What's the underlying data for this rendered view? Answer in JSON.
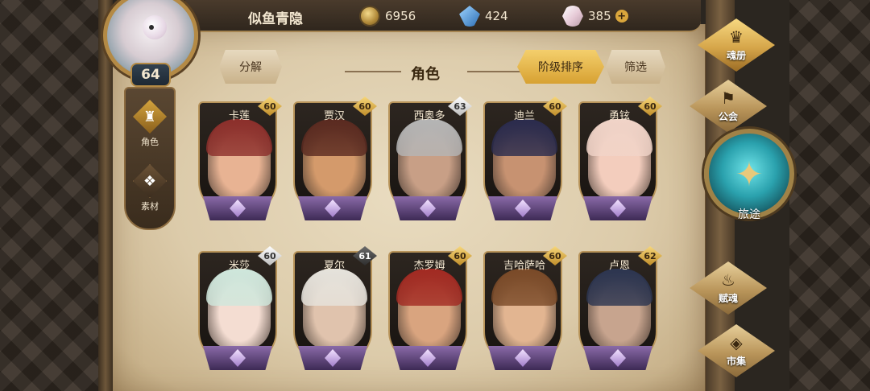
{
  "player": {
    "name": "似鱼青隐",
    "level": "64"
  },
  "resources": {
    "coins": "6956",
    "crystals": "424",
    "gems": "385",
    "add_symbol": "+"
  },
  "leftnav": [
    {
      "label": "角色",
      "icon": "helmet-icon",
      "active": true
    },
    {
      "label": "素材",
      "icon": "beast-icon",
      "active": false
    }
  ],
  "header": {
    "split_label": "分解",
    "title": "角色",
    "sort_label": "阶级排序",
    "filter_label": "筛选"
  },
  "heroes": [
    {
      "name": "卡莲",
      "level": "60",
      "tier": "gold",
      "hair": "#8c2f2b",
      "skin": "#e8b393"
    },
    {
      "name": "贾汉",
      "level": "60",
      "tier": "gold",
      "hair": "#5a2a20",
      "skin": "#d49a6b"
    },
    {
      "name": "西奥多",
      "level": "63",
      "tier": "silver",
      "hair": "#b5b5b5",
      "skin": "#c89f86"
    },
    {
      "name": "迪兰",
      "level": "60",
      "tier": "gold",
      "hair": "#2a2b4d",
      "skin": "#c79271"
    },
    {
      "name": "勇铉",
      "level": "60",
      "tier": "gold",
      "hair": "#f1d4c8",
      "skin": "#f3cdbd"
    },
    {
      "name": "米莎",
      "level": "60",
      "tier": "silver",
      "hair": "#cfe7dc",
      "skin": "#f4ddd2"
    },
    {
      "name": "夏尔",
      "level": "61",
      "tier": "dark",
      "hair": "#e6e3dc",
      "skin": "#e0c3ad"
    },
    {
      "name": "杰罗姆",
      "level": "60",
      "tier": "gold",
      "hair": "#a22a22",
      "skin": "#d9a47f"
    },
    {
      "name": "吉哈萨哈",
      "level": "60",
      "tier": "gold",
      "hair": "#7a4a28",
      "skin": "#e2b591"
    },
    {
      "name": "卢恩",
      "level": "62",
      "tier": "gold",
      "hair": "#2c3550",
      "skin": "#c7a48e"
    }
  ],
  "rightnav": {
    "codex": "魂册",
    "guild": "公会",
    "journey": "旅途",
    "soul": "赋魂",
    "market": "市集"
  }
}
